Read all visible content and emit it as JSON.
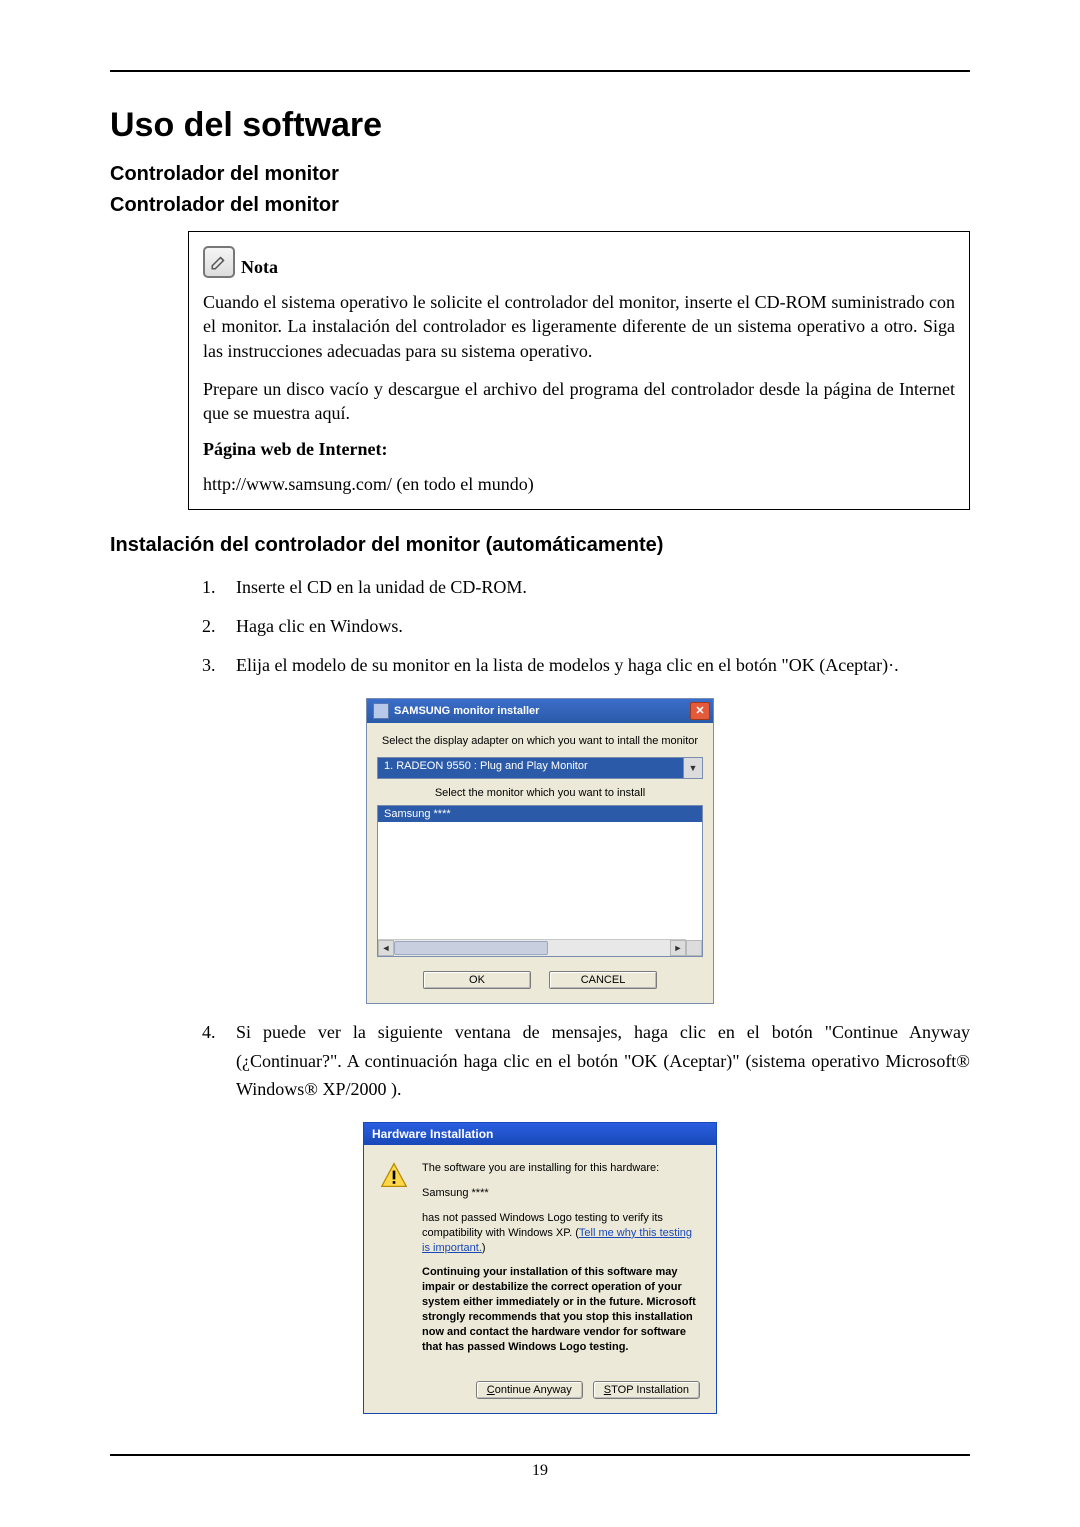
{
  "title": "Uso del software",
  "headings": {
    "h2a": "Controlador del monitor",
    "h2b": "Controlador del monitor",
    "install": "Instalación del controlador del monitor (automáticamente)"
  },
  "note": {
    "label": "Nota",
    "p1": "Cuando el sistema operativo le solicite el controlador del monitor, inserte el CD-ROM suministrado con el monitor. La instalación del controlador es ligeramente diferente de un sistema operativo a otro. Siga las instrucciones adecuadas para su sistema operativo.",
    "p2": "Prepare un disco vacío y descargue el archivo del programa del controlador desde la página de Internet que se muestra aquí.",
    "webLabel": "Página web de Internet:",
    "url": "http://www.samsung.com/ (en todo el mundo)"
  },
  "steps": {
    "s1": "Inserte el CD en la unidad de CD-ROM.",
    "s2": "Haga clic en Windows.",
    "s3": "Elija el modelo de su monitor en la lista de modelos y haga clic en el botón \"OK (Aceptar)·.",
    "s4": "Si puede ver la siguiente ventana de mensajes, haga clic en el botón \"Continue Anyway (¿Continuar?\". A continuación haga clic en el botón \"OK (Aceptar)\" (sistema operativo Microsoft® Windows® XP/2000 )."
  },
  "installer": {
    "title": "SAMSUNG monitor installer",
    "label1": "Select the display adapter on which you want to intall the monitor",
    "combo": "1. RADEON 9550 : Plug and Play Monitor",
    "label2": "Select the monitor which you want to install",
    "listItem": "Samsung ****",
    "ok": "OK",
    "cancel": "CANCEL"
  },
  "hw": {
    "title": "Hardware Installation",
    "line1": "The software you are installing for this hardware:",
    "line2": "Samsung ****",
    "line3a": "has not passed Windows Logo testing to verify its compatibility with Windows XP. (",
    "link": "Tell me why this testing is important.",
    "line3b": ")",
    "bold": "Continuing your installation of this software may impair or destabilize the correct operation of your system either immediately or in the future. Microsoft strongly recommends that you stop this installation now and contact the hardware vendor for software that has passed Windows Logo testing.",
    "btnContinue": "Continue Anyway",
    "btnStop": "STOP Installation"
  },
  "pageNumber": "19"
}
